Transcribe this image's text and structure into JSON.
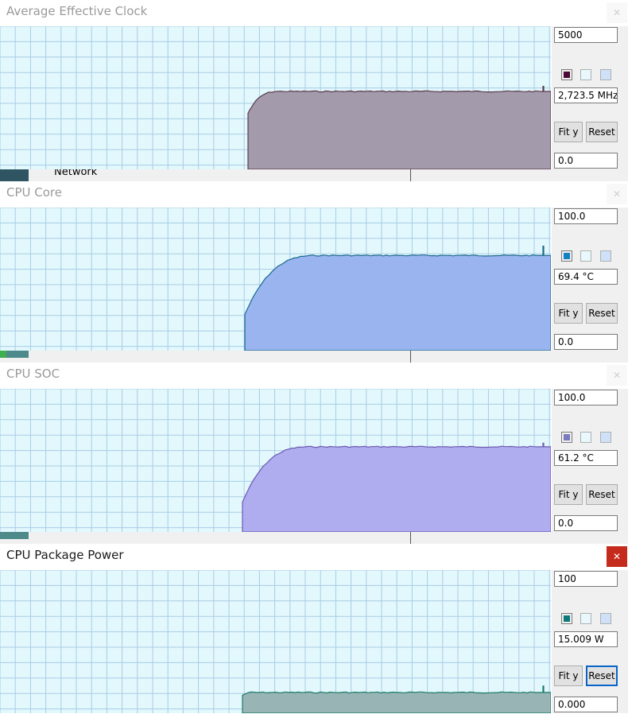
{
  "panels": [
    {
      "id": "avg-clock",
      "title": "Average Effective Clock",
      "close_glyph": "✕",
      "max_value": "5000",
      "current_value": "2,723.5 MHz",
      "min_value": "0.0",
      "fit_label": "Fit y",
      "reset_label": "Reset",
      "line_color": "#5a3a48",
      "fill_color": "#a39aac",
      "swatch_color": "#4a0a36",
      "scale_max": 5000,
      "history": {
        "start": 0.45,
        "level": 2723.5,
        "rise": 0.06,
        "rise_start_frac": 0.72,
        "spike": 2900
      },
      "active": false
    },
    {
      "id": "cpu-core",
      "title": "CPU Core",
      "close_glyph": "✕",
      "max_value": "100.0",
      "current_value": "69.4 °C",
      "min_value": "0.0",
      "fit_label": "Fit y",
      "reset_label": "Reset",
      "line_color": "#1a6a8a",
      "fill_color": "#9ab4f0",
      "swatch_color": "#1380c4",
      "scale_max": 100,
      "history": {
        "start": 0.445,
        "level": 66.5,
        "rise": 0.14,
        "rise_start_frac": 0.38,
        "spike": 73
      },
      "active": false
    },
    {
      "id": "cpu-soc",
      "title": "CPU SOC",
      "close_glyph": "✕",
      "max_value": "100.0",
      "current_value": "61.2 °C",
      "min_value": "0.0",
      "fit_label": "Fit y",
      "reset_label": "Reset",
      "line_color": "#6a5ab0",
      "fill_color": "#b0acf0",
      "swatch_color": "#7a7ac0",
      "scale_max": 100,
      "history": {
        "start": 0.44,
        "level": 59.5,
        "rise": 0.13,
        "rise_start_frac": 0.35,
        "spike": 62
      },
      "active": false
    },
    {
      "id": "cpu-package-power",
      "title": "CPU Package Power",
      "close_glyph": "✕",
      "max_value": "100",
      "current_value": "15.009 W",
      "min_value": "0.000",
      "fit_label": "Fit y",
      "reset_label": "Reset",
      "line_color": "#1a7a6a",
      "fill_color": "#98b4b4",
      "swatch_color": "#0a7a7a",
      "scale_max": 100,
      "history": {
        "start": 0.44,
        "level": 14.5,
        "rise": 0.02,
        "rise_start_frac": 0.86,
        "spike": 19
      },
      "active": true
    }
  ],
  "background": {
    "network_label": "Network"
  },
  "colors": {
    "graph_bg": "#e2f8fc",
    "grid": "#a9cce6"
  }
}
